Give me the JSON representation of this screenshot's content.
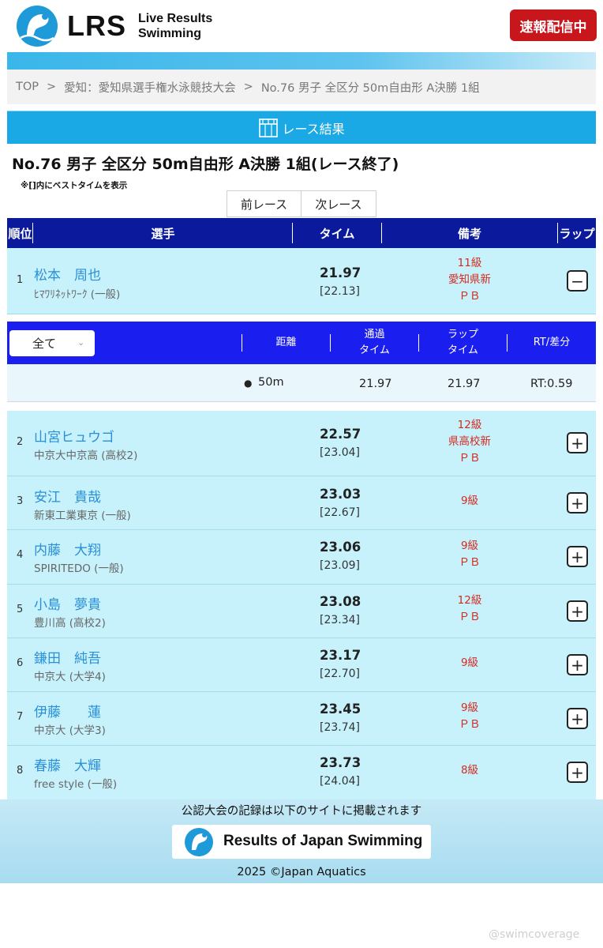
{
  "header": {
    "logo_text": "LRS",
    "logo_sub_line1": "Live Results",
    "logo_sub_line2": "Swimming",
    "live_badge": "速報配信中"
  },
  "breadcrumb": {
    "items": [
      "TOP",
      "愛知：愛知県選手権水泳競技大会",
      "No.76 男子 全区分 50m自由形 A決勝 1組"
    ],
    "separator": ">"
  },
  "section": {
    "title": "レース結果",
    "icon": "pool-lanes-icon"
  },
  "race": {
    "title": "No.76 男子 全区分 50m自由形 A決勝 1組(レース終了)",
    "note": "※[]内にベストタイムを表示",
    "prev_label": "前レース",
    "next_label": "次レース"
  },
  "table_header": {
    "rank": "順位",
    "swimmer": "選手",
    "time": "タイム",
    "remarks": "備考",
    "lap": "ラップ"
  },
  "results": [
    {
      "rank": "1",
      "name": "松本　周也",
      "team": "ﾋﾏﾜﾘﾈｯﾄﾜｰｸ (一般)",
      "time": "21.97",
      "best": "[22.13]",
      "notes": [
        "11級",
        "愛知県新",
        "ＰＢ"
      ],
      "toggle": "−",
      "expanded": true
    },
    {
      "rank": "2",
      "name": "山宮ヒュウゴ",
      "team": "中京大中京高 (高校2)",
      "time": "22.57",
      "best": "[23.04]",
      "notes": [
        "12級",
        "県高校新",
        "ＰＢ"
      ],
      "toggle": "+"
    },
    {
      "rank": "3",
      "name": "安江　貴哉",
      "team": "新東工業東京 (一般)",
      "time": "23.03",
      "best": "[22.67]",
      "notes": [
        "9級"
      ],
      "toggle": "+"
    },
    {
      "rank": "4",
      "name": "内藤　大翔",
      "team": "SPIRITEDO (一般)",
      "time": "23.06",
      "best": "[23.09]",
      "notes": [
        "9級",
        "ＰＢ"
      ],
      "toggle": "+"
    },
    {
      "rank": "5",
      "name": "小島　夢貴",
      "team": "豊川高 (高校2)",
      "time": "23.08",
      "best": "[23.34]",
      "notes": [
        "12級",
        "ＰＢ"
      ],
      "toggle": "+"
    },
    {
      "rank": "6",
      "name": "鎌田　純吾",
      "team": "中京大 (大学4)",
      "time": "23.17",
      "best": "[22.70]",
      "notes": [
        "9級"
      ],
      "toggle": "+"
    },
    {
      "rank": "7",
      "name": "伊藤　　蓮",
      "team": "中京大 (大学3)",
      "time": "23.45",
      "best": "[23.74]",
      "notes": [
        "9級",
        "ＰＢ"
      ],
      "toggle": "+"
    },
    {
      "rank": "8",
      "name": "春藤　大輝",
      "team": "free style (一般)",
      "time": "23.73",
      "best": "[24.04]",
      "notes": [
        "8級"
      ],
      "toggle": "+"
    }
  ],
  "lap_table": {
    "filter_value": "全て",
    "headers": {
      "distance": "距離",
      "pass_time_1": "通過",
      "pass_time_2": "タイム",
      "lap_time_1": "ラップ",
      "lap_time_2": "タイム",
      "rt": "RT/差分"
    },
    "rows": [
      {
        "distance": "50m",
        "pass_time": "21.97",
        "lap_time": "21.97",
        "rt": "RT:0.59"
      }
    ]
  },
  "footer": {
    "message": "公認大会の記録は以下のサイトに掲載されます",
    "banner_text": "Results of Japan Swimming",
    "copyright": "2025 ©Japan Aquatics"
  },
  "watermark": "@swimcoverage",
  "colors": {
    "accent": "#1ba9e6",
    "header_navy": "#0b1a9c",
    "lap_header_blue": "#1a1fef",
    "row_bg": "#c7f2fb",
    "name_blue": "#2a8fd6",
    "note_red": "#d42a1e",
    "live_red": "#c8161d"
  }
}
